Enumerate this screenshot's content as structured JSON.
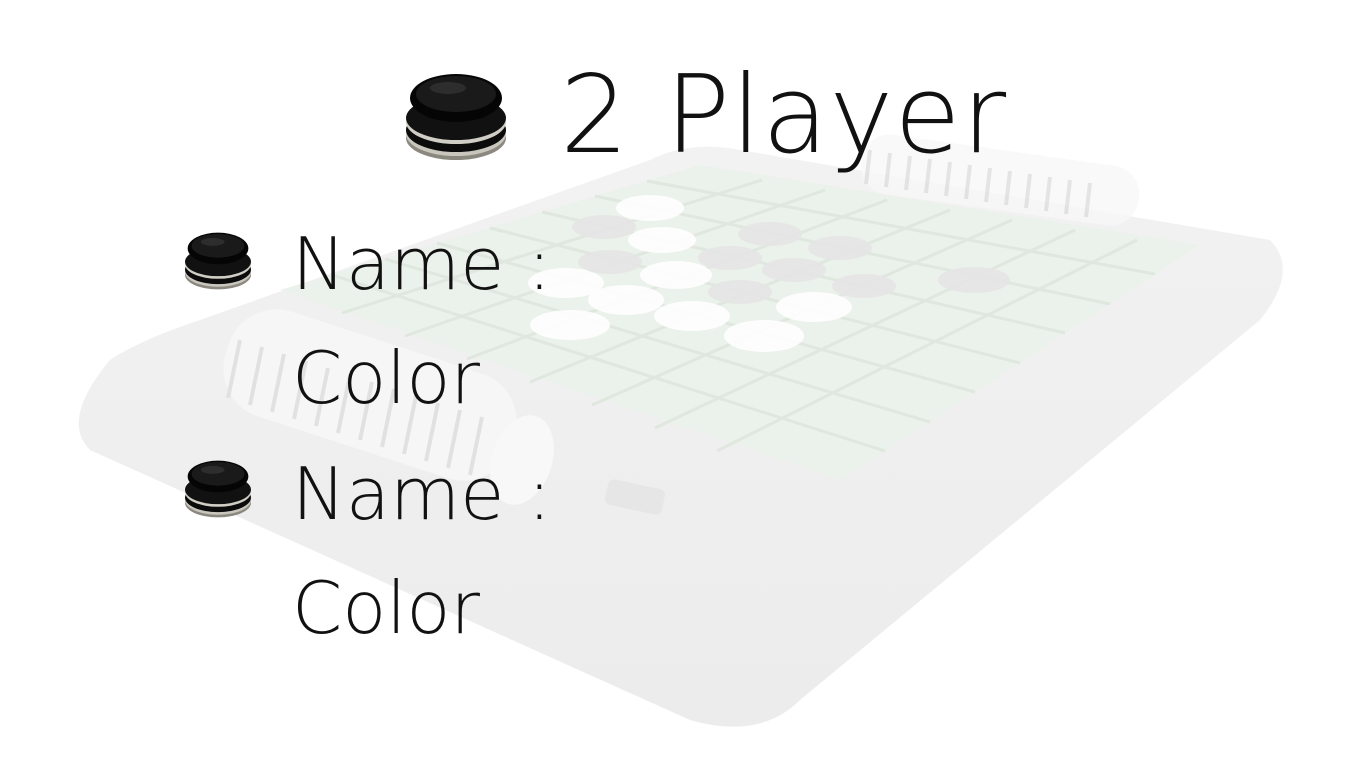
{
  "screen": {
    "title": "2 Player"
  },
  "players": [
    {
      "name_label": "Name :",
      "color_label": "Color"
    },
    {
      "name_label": "Name :",
      "color_label": "Color"
    }
  ],
  "icons": {
    "title_icon": "stacked-black-disc-icon",
    "player_icon": "stacked-black-disc-icon"
  },
  "colors": {
    "text": "#111111",
    "disc_black": "#0a0a0a",
    "disc_rim": "#b8b6ad",
    "board_bg": "#f1f1f1"
  }
}
